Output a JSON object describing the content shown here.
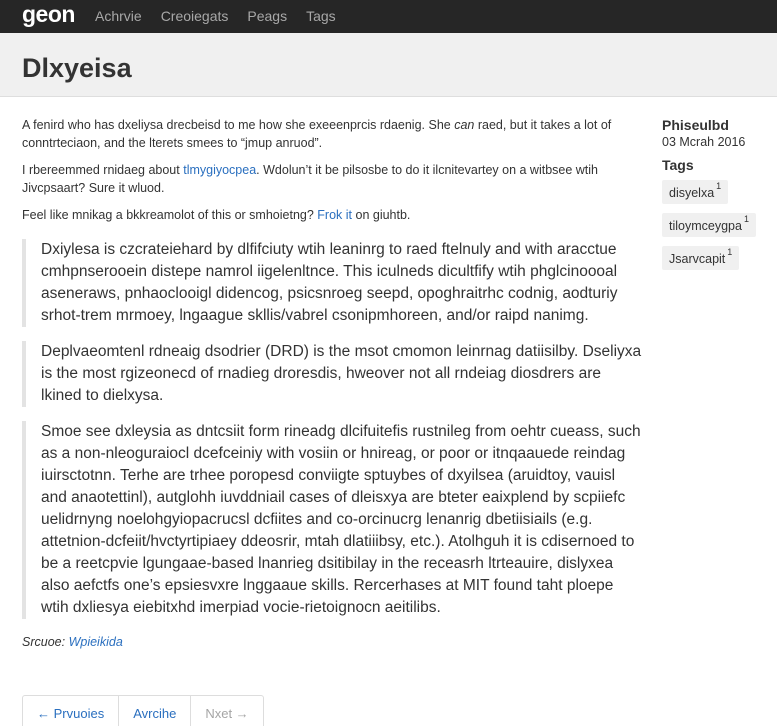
{
  "navbar": {
    "brand": "geon",
    "items": [
      "Achrvie",
      "Creoiegats",
      "Peags",
      "Tags"
    ]
  },
  "header": {
    "title": "Dlxyeisa"
  },
  "post": {
    "intro_prefix": "A fenird who has dxeliysa drecbeisd to me how she exeeenprcis rdaenig. She ",
    "intro_em": "can",
    "intro_suffix": " raed, but it takes a lot of conntrteciaon, and the lterets smees to “jmup anruod”.",
    "p2_prefix": "I rbereemmed rnidaeg about ",
    "p2_link": "tlmygiyocpea",
    "p2_suffix": ". Wdolun’t it be pilsosbe to do it ilcnitevartey on a witbsee wtih Jivcpsaart? Sure it wluod.",
    "p3_prefix": "Feel like mnikag a bkkreamolot of this or smhoietng? ",
    "p3_link": "Frok it",
    "p3_suffix": " on giuhtb.",
    "quotes": [
      "Dxiylesa is czcrateiehard by dlfifciuty wtih leaninrg to raed ftelnuly and with aracctue cmhpnserooein distepe namrol iigelenltnce. This iculneds dicultfify wtih phglcinoooal aseneraws, pnhaoclooigl didencog, psicsnroeg seepd, opoghraitrhc codnig, aodturiy srhot-trem mrmoey, lngaague skllis/vabrel csonipmhoreen, and/or raipd nanimg.",
      "Deplvaeomtenl rdneaig dsodrier (DRD) is the msot cmomon leinrnag datiisilby. Dseliyxa is the most rgizeonecd of rnadieg droresdis, hweover not all rndeiag diosdrers are lkined to dielxysa.",
      "Smoe see dxleysia as dntcsiit form rineadg dlcifuitefis rustnileg from oehtr cueass, such as a non-nleoguraiocl dcefceiniy with vosiin or hnireag, or poor or itnqaauede reindag iuirsctotnn. Terhe are trhee poropesd conviigte sptuybes of dxyilsea (aruidtoy, vauisl and anaotettinl), autglohh iuvddniail cases of dleisxya are bteter eaixplend by scpiiefc uelidrnyng noelohgyiopacrucsl dcfiites and co-orcinucrg lenanrig dbetiisiails (e.g. attetnion-dcfeiit/hvctyrtipiaey ddeosrir, mtah dlatiiibsy, etc.). Atolhguh it is cdisernoed to be a reetcpvie lgungaae-based lnanrieg dsitibilay in the receasrh ltrteauire, dislyxea also aefctfs one’s epsiesvxre lnggaaue skills. Rercerhases at MIT found taht ploepe wtih dxliesya eiebitxhd imerpiad vocie-rietoignocn aeitilibs."
    ],
    "source_label": "Srcuoe:",
    "source_link": "Wpieikida"
  },
  "sidebar": {
    "author": "Phiseulbd",
    "date": "03 Mcrah 2016",
    "tags_heading": "Tags",
    "tags": [
      {
        "name": "disyelxa",
        "count": "1"
      },
      {
        "name": "tiloymceygpa",
        "count": "1"
      },
      {
        "name": "Jsarvcapit",
        "count": "1"
      }
    ]
  },
  "pager": {
    "previous": "← Prvuoies",
    "archive": "Avrcihe",
    "next": "Nxet →"
  },
  "colors": {
    "navbar_bg": "#262626",
    "header_bg": "#f0f0f0",
    "link": "#2a6fbf"
  }
}
